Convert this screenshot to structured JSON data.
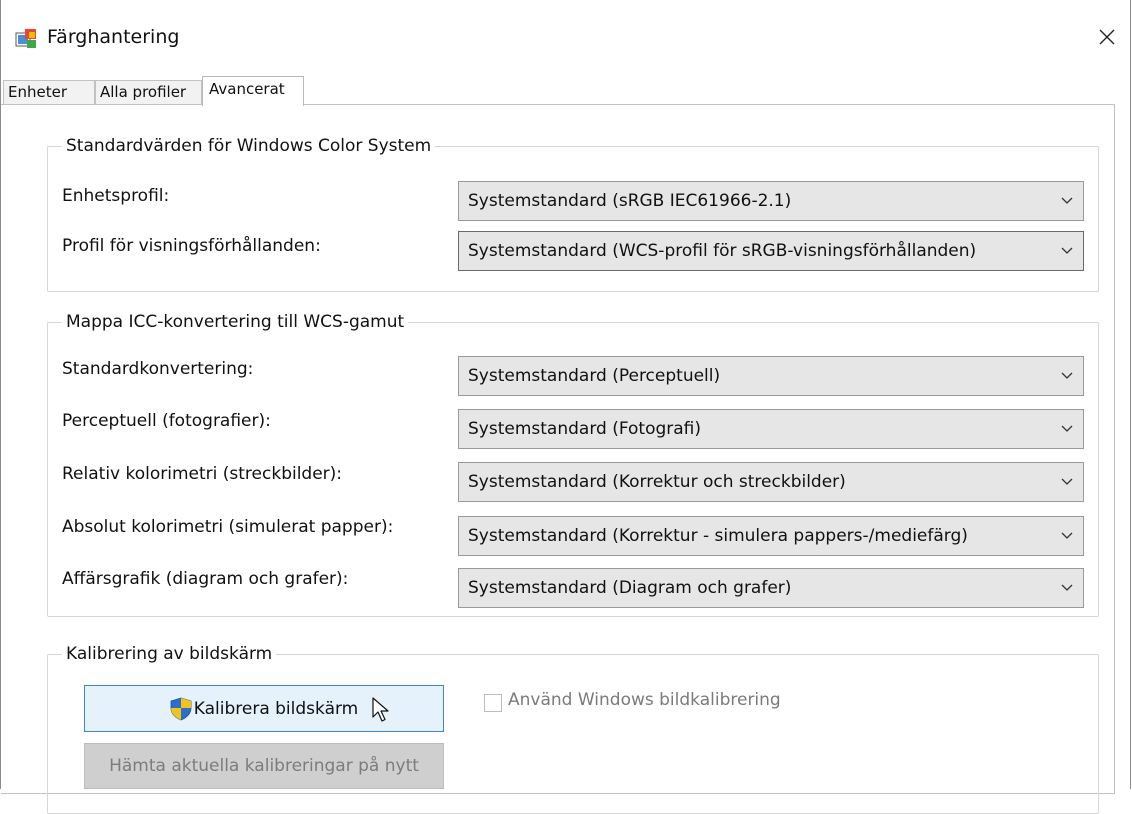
{
  "window": {
    "title": "Färghantering",
    "close_icon": "close-icon"
  },
  "tabs": [
    {
      "label": "Enheter",
      "active": false
    },
    {
      "label": "Alla profiler",
      "active": false
    },
    {
      "label": "Avancerat",
      "active": true
    }
  ],
  "wcs_defaults": {
    "legend": "Standardvärden för Windows Color System",
    "device_profile": {
      "label": "Enhetsprofil:",
      "value": "Systemstandard (sRGB IEC61966-2.1)"
    },
    "viewing_conditions": {
      "label": "Profil för visningsförhållanden:",
      "value": "Systemstandard (WCS-profil för sRGB-visningsförhållanden)"
    }
  },
  "icc_mapping": {
    "legend": "Mappa ICC-konvertering till WCS-gamut",
    "rows": [
      {
        "label": "Standardkonvertering:",
        "value": "Systemstandard (Perceptuell)"
      },
      {
        "label": "Perceptuell (fotografier):",
        "value": "Systemstandard (Fotografi)"
      },
      {
        "label": "Relativ kolorimetri (streckbilder):",
        "value": "Systemstandard (Korrektur och streckbilder)"
      },
      {
        "label": "Absolut kolorimetri (simulerat papper):",
        "value": "Systemstandard (Korrektur - simulera pappers-/mediefärg)"
      },
      {
        "label": "Affärsgrafik (diagram och grafer):",
        "value": "Systemstandard (Diagram och grafer)"
      }
    ]
  },
  "calibration": {
    "legend": "Kalibrering av bildskärm",
    "calibrate_button": "Kalibrera bildskärm",
    "reload_button": "Hämta aktuella kalibreringar på nytt",
    "use_windows_calibration": {
      "label": "Använd Windows bildkalibrering",
      "checked": false,
      "enabled": false
    }
  },
  "colors": {
    "accent": "#3c87d2",
    "button_bg": "#e5f1fb",
    "combo_bg": "#e6e6e6"
  }
}
